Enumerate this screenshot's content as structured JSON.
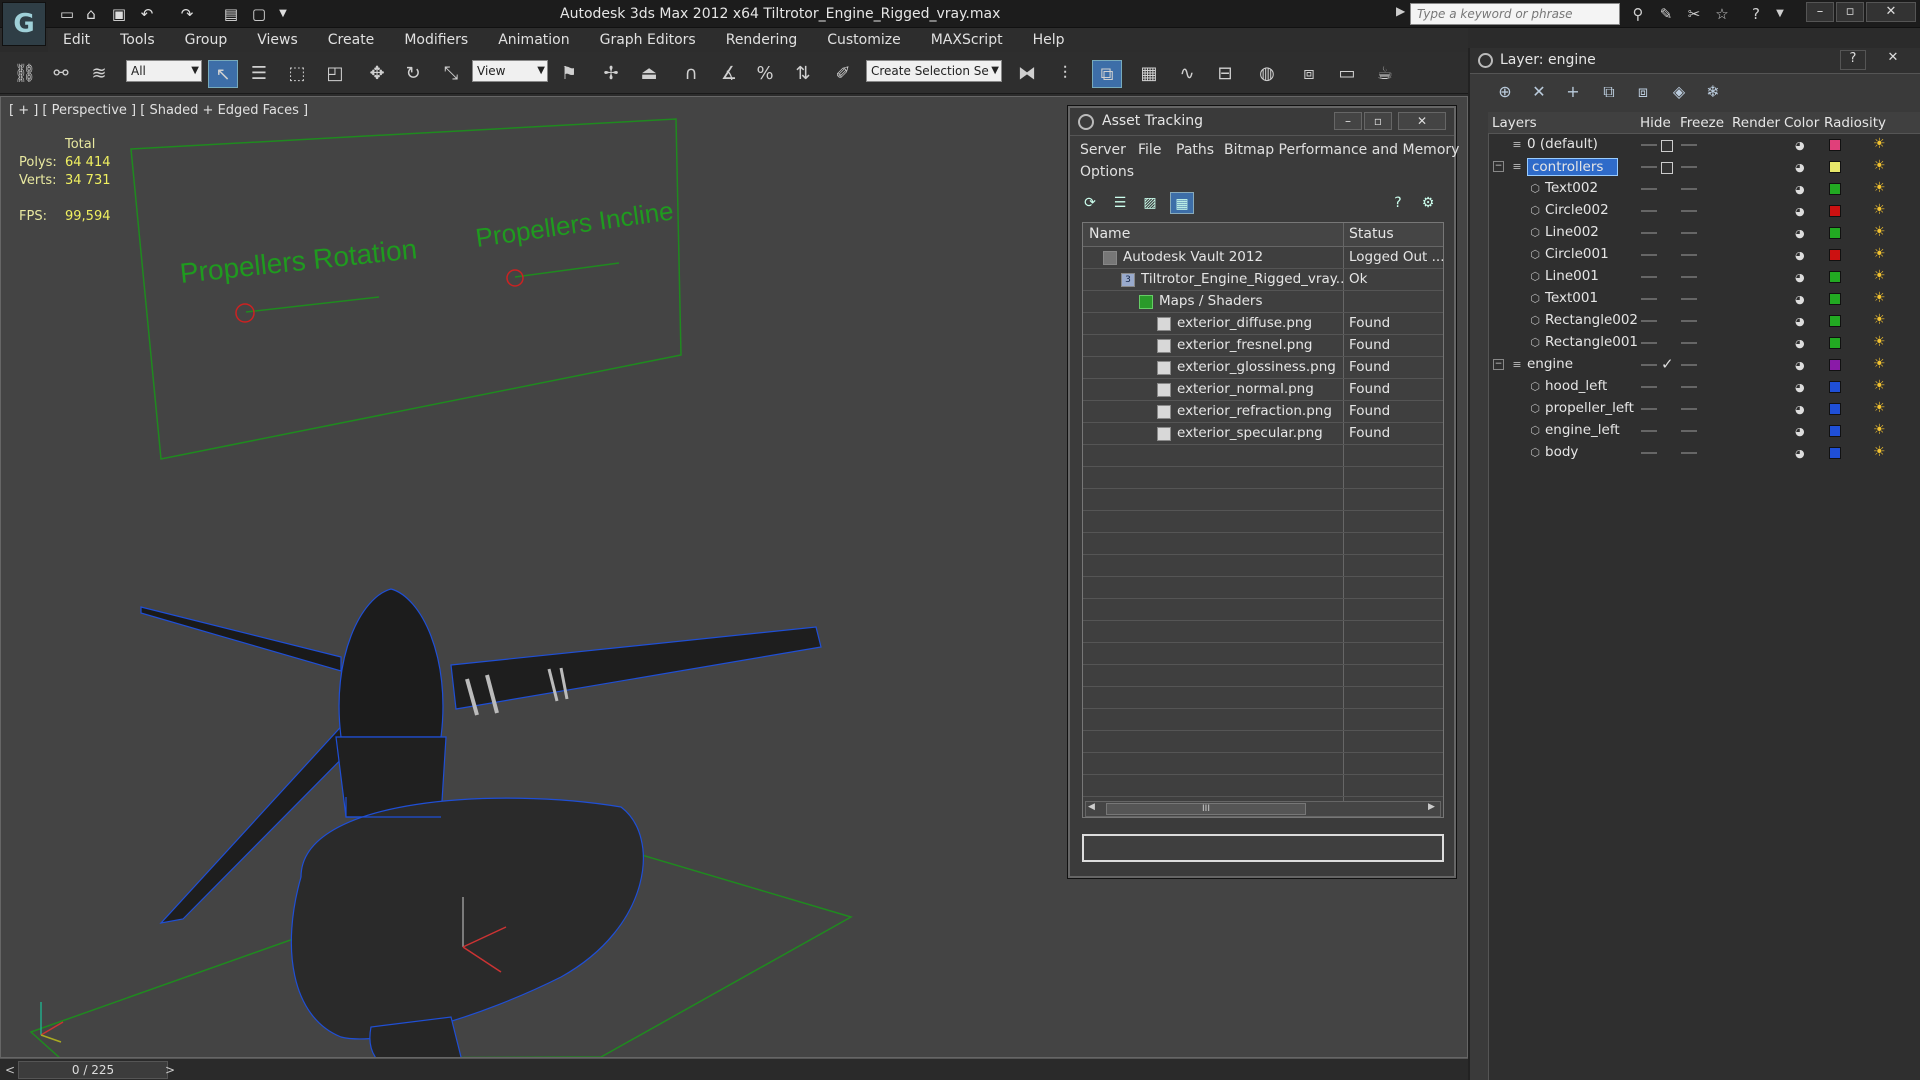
{
  "app": {
    "title": "Autodesk 3ds Max  2012 x64     Tiltrotor_Engine_Rigged_vray.max",
    "search_placeholder": "Type a keyword or phrase",
    "logo_glyph": "G"
  },
  "menu": [
    "Edit",
    "Tools",
    "Group",
    "Views",
    "Create",
    "Modifiers",
    "Animation",
    "Graph Editors",
    "Rendering",
    "Customize",
    "MAXScript",
    "Help"
  ],
  "toolbar": {
    "filter_combo": "All",
    "refcoord_combo": "View",
    "selection_set_combo": "Create Selection Se"
  },
  "viewport": {
    "label": "[ + ] [ Perspective ] [ Shaded + Edged Faces ]",
    "stats": {
      "total_label": "Total",
      "polys_label": "Polys:",
      "polys_value": "64 414",
      "verts_label": "Verts:",
      "verts_value": "34 731",
      "fps_label": "FPS:",
      "fps_value": "99,594"
    },
    "text_objects": [
      "Propellers Rotation",
      "Propellers Incline"
    ],
    "wire_color": "#1f4fd6",
    "helper_color": "#1f8a1f"
  },
  "timebar": {
    "frame": "0 / 225",
    "prev": "<",
    "next": ">"
  },
  "asset_tracking": {
    "title": "Asset Tracking",
    "menu": [
      "Server",
      "File",
      "Paths",
      "Bitmap Performance and Memory",
      "Options"
    ],
    "columns": {
      "name": "Name",
      "status": "Status"
    },
    "rows": [
      {
        "name": "Autodesk Vault 2012",
        "status": "Logged Out ...",
        "indent": 0,
        "icon": "vault-icon"
      },
      {
        "name": "Tiltrotor_Engine_Rigged_vray....",
        "status": "Ok",
        "indent": 1,
        "icon": "max-file-icon"
      },
      {
        "name": "Maps / Shaders",
        "status": "",
        "indent": 2,
        "icon": "maps-icon"
      },
      {
        "name": "exterior_diffuse.png",
        "status": "Found",
        "indent": 3,
        "icon": "bitmap-icon"
      },
      {
        "name": "exterior_fresnel.png",
        "status": "Found",
        "indent": 3,
        "icon": "bitmap-icon"
      },
      {
        "name": "exterior_glossiness.png",
        "status": "Found",
        "indent": 3,
        "icon": "bitmap-icon"
      },
      {
        "name": "exterior_normal.png",
        "status": "Found",
        "indent": 3,
        "icon": "bitmap-icon"
      },
      {
        "name": "exterior_refraction.png",
        "status": "Found",
        "indent": 3,
        "icon": "bitmap-icon"
      },
      {
        "name": "exterior_specular.png",
        "status": "Found",
        "indent": 3,
        "icon": "bitmap-icon"
      }
    ],
    "scroll_thumb": "III"
  },
  "layer_panel": {
    "title": "Layer: engine",
    "columns": [
      "Layers",
      "Hide",
      "Freeze",
      "Render",
      "Color",
      "Radiosity"
    ],
    "rows": [
      {
        "name": "0 (default)",
        "level": 0,
        "kind": "layer",
        "check": "box",
        "color": "#e0407a"
      },
      {
        "name": "controllers",
        "level": 0,
        "kind": "layer",
        "check": "box",
        "color": "#e8e86a",
        "selected": true,
        "expanded": true
      },
      {
        "name": "Text002",
        "level": 1,
        "kind": "object",
        "color": "#22aa22"
      },
      {
        "name": "Circle002",
        "level": 1,
        "kind": "object",
        "color": "#cc1111"
      },
      {
        "name": "Line002",
        "level": 1,
        "kind": "object",
        "color": "#22aa22"
      },
      {
        "name": "Circle001",
        "level": 1,
        "kind": "object",
        "color": "#cc1111"
      },
      {
        "name": "Line001",
        "level": 1,
        "kind": "object",
        "color": "#22aa22"
      },
      {
        "name": "Text001",
        "level": 1,
        "kind": "object",
        "color": "#22aa22"
      },
      {
        "name": "Rectangle002",
        "level": 1,
        "kind": "object",
        "color": "#22aa22"
      },
      {
        "name": "Rectangle001",
        "level": 1,
        "kind": "object",
        "color": "#22aa22"
      },
      {
        "name": "engine",
        "level": 0,
        "kind": "layer",
        "check": "tick",
        "color": "#8a1aa8",
        "expanded": true
      },
      {
        "name": "hood_left",
        "level": 1,
        "kind": "object",
        "color": "#1f4fd6"
      },
      {
        "name": "propeller_left",
        "level": 1,
        "kind": "object",
        "color": "#1f4fd6"
      },
      {
        "name": "engine_left",
        "level": 1,
        "kind": "object",
        "color": "#1f4fd6"
      },
      {
        "name": "body",
        "level": 1,
        "kind": "object",
        "color": "#1f4fd6"
      }
    ]
  }
}
